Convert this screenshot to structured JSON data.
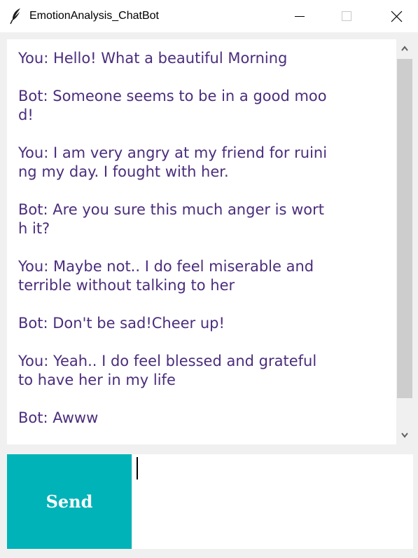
{
  "window": {
    "title": "EmotionAnalysis_ChatBot",
    "app_icon": "feather-icon",
    "controls": [
      "minimize-icon",
      "maximize-icon",
      "close-icon"
    ]
  },
  "chat": {
    "lines": [
      "You: Hello! What a beautiful Morning",
      "",
      "Bot: Someone seems to be in a good moo",
      "d!",
      "",
      "You: I am very angry at my friend for ruini",
      "ng my day. I fought with her.",
      "",
      "Bot: Are you sure this much anger is wort",
      "h it?",
      "",
      "You: Maybe not.. I do feel miserable and",
      "terrible without talking to her",
      "",
      "Bot: Don't be sad!Cheer up!",
      "",
      "You: Yeah.. I do feel blessed and grateful",
      "to have her in my life",
      "",
      "Bot: Awww"
    ],
    "text_color": "#4b2d7c"
  },
  "scrollbar": {
    "up_icon": "chevron-up-icon",
    "down_icon": "chevron-down-icon"
  },
  "input": {
    "send_label": "Send",
    "send_color": "#00b3b8",
    "value": ""
  }
}
